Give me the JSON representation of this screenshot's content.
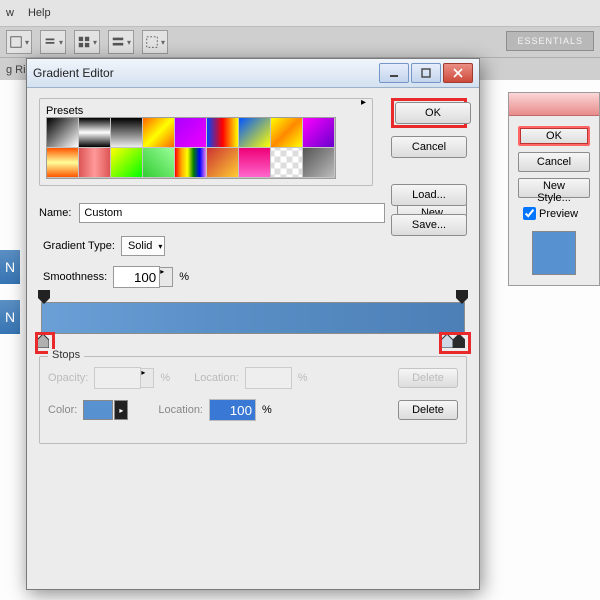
{
  "menubar": {
    "view": "w",
    "help": "Help"
  },
  "toolbar": {
    "essentials": "ESSENTIALS"
  },
  "options": {
    "file_fragment": "g Ring"
  },
  "side_tabs": {
    "t1": "N",
    "t2": "N"
  },
  "side_dialog": {
    "ok": "OK",
    "cancel": "Cancel",
    "new_style": "New Style...",
    "preview": "Preview"
  },
  "dialog": {
    "title": "Gradient Editor",
    "buttons": {
      "ok": "OK",
      "cancel": "Cancel",
      "load": "Load...",
      "save": "Save...",
      "newbtn": "New"
    },
    "presets_label": "Presets",
    "name_label": "Name:",
    "name_value": "Custom",
    "gtype_label": "Gradient Type:",
    "gtype_value": "Solid",
    "smooth_label": "Smoothness:",
    "smooth_value": "100",
    "pct": "%",
    "stops": {
      "legend": "Stops",
      "opacity": "Opacity:",
      "location": "Location:",
      "color": "Color:",
      "loc_value": "100",
      "delete": "Delete"
    }
  },
  "presets": [
    "linear-gradient(135deg,#000,#fff)",
    "linear-gradient(#000,#fff,#000)",
    "linear-gradient(#000,transparent)",
    "linear-gradient(135deg,#f60,#ff0,#f60)",
    "linear-gradient(135deg,#a0f,#e0f)",
    "linear-gradient(90deg,#04f,#f00,#ff0)",
    "linear-gradient(135deg,#05f,#ff0)",
    "linear-gradient(135deg,#ff0,#f80,#ff0)",
    "linear-gradient(135deg,#f0f,#60c)",
    "linear-gradient(#f50,#ff9,#f50)",
    "linear-gradient(90deg,#d55,#f99,#d55)",
    "linear-gradient(135deg,#ff0,#0f0)",
    "linear-gradient(45deg,#3c3,#9f9)",
    "linear-gradient(90deg,red,orange,yellow,green,blue,violet)",
    "linear-gradient(135deg,#c33,#fc3)",
    "linear-gradient(#e07,#f6c)",
    "repeating-conic-gradient(#ddd 0 25%,#fff 0 50%) 50%/12px 12px",
    "linear-gradient(135deg,#555,#bbb)"
  ]
}
